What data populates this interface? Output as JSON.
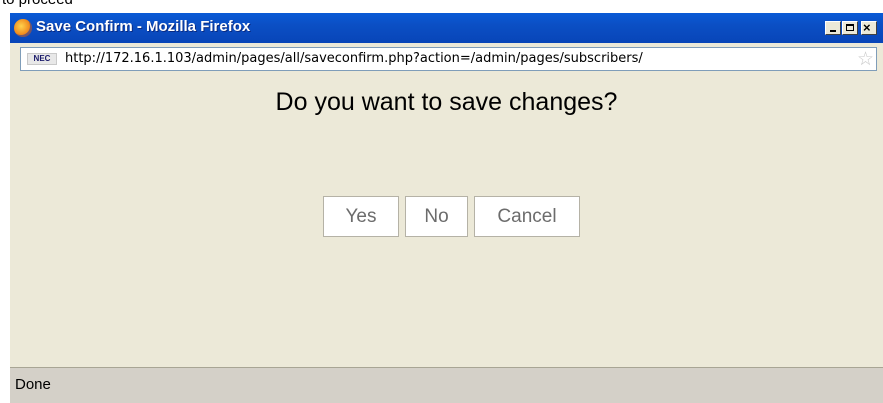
{
  "top_fragment": "to proceed",
  "window": {
    "title": "Save Confirm - Mozilla Firefox",
    "controls": {
      "minimize": "_",
      "maximize": "□",
      "close": "×"
    }
  },
  "urlbar": {
    "site_icon_text": "NEC",
    "url": "http://172.16.1.103/admin/pages/all/saveconfirm.php?action=/admin/pages/subscribers/"
  },
  "dialog": {
    "question": "Do you want to save changes?",
    "buttons": {
      "yes": "Yes",
      "no": "No",
      "cancel": "Cancel"
    }
  },
  "status": {
    "text": "Done"
  },
  "icons": [
    "firefox-icon",
    "site-icon",
    "bookmark-star-icon",
    "minimize-icon",
    "maximize-icon",
    "close-icon"
  ]
}
